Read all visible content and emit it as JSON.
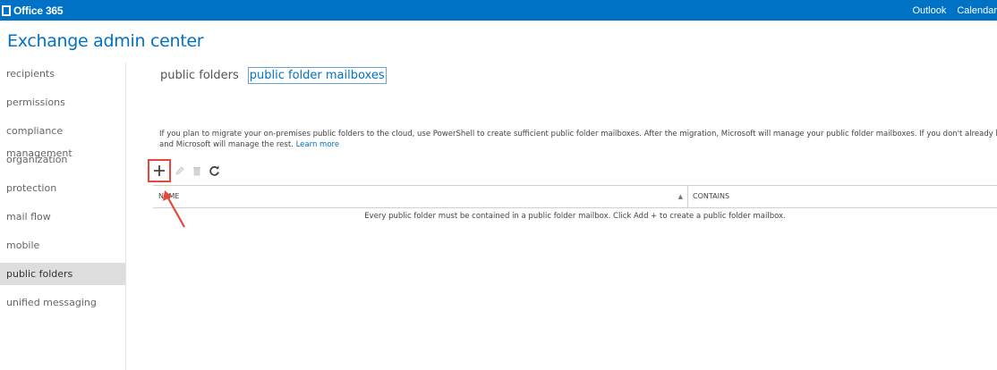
{
  "topbar": {
    "logo_text": "Office 365",
    "links": [
      "Outlook",
      "Calendar"
    ],
    "color": "#0072c6"
  },
  "app": {
    "title": "Exchange admin center"
  },
  "sidebar": {
    "items": [
      {
        "label": "recipients"
      },
      {
        "label": "permissions"
      },
      {
        "label": "compliance management"
      },
      {
        "label": "organization"
      },
      {
        "label": "protection"
      },
      {
        "label": "mail flow"
      },
      {
        "label": "mobile"
      },
      {
        "label": "public folders",
        "active": true
      },
      {
        "label": "unified messaging"
      }
    ]
  },
  "tabs": [
    {
      "label": "public folders"
    },
    {
      "label": "public folder mailboxes",
      "active": true
    }
  ],
  "info": {
    "line1": "If you plan to migrate your on-premises public folders to the cloud, use PowerShell to create sufficient public folder mailboxes. After the migration, Microsoft will manage your public folder mailboxes. If you don't already have public folders",
    "line2": "and Microsoft will manage the rest.",
    "link": "Learn more"
  },
  "toolbar": {
    "buttons": [
      {
        "icon": "add-icon",
        "highlighted": true
      },
      {
        "icon": "edit-icon"
      },
      {
        "icon": "delete-icon"
      },
      {
        "icon": "refresh-icon"
      }
    ]
  },
  "grid": {
    "columns": [
      "NAME",
      "CONTAINS"
    ],
    "empty_message": "Every public folder must be contained in a public folder mailbox. Click Add + to create a public folder mailbox."
  },
  "colors": {
    "accent": "#0072c6",
    "highlight": "#e8463b",
    "nav_active_bg": "#dddddd"
  }
}
